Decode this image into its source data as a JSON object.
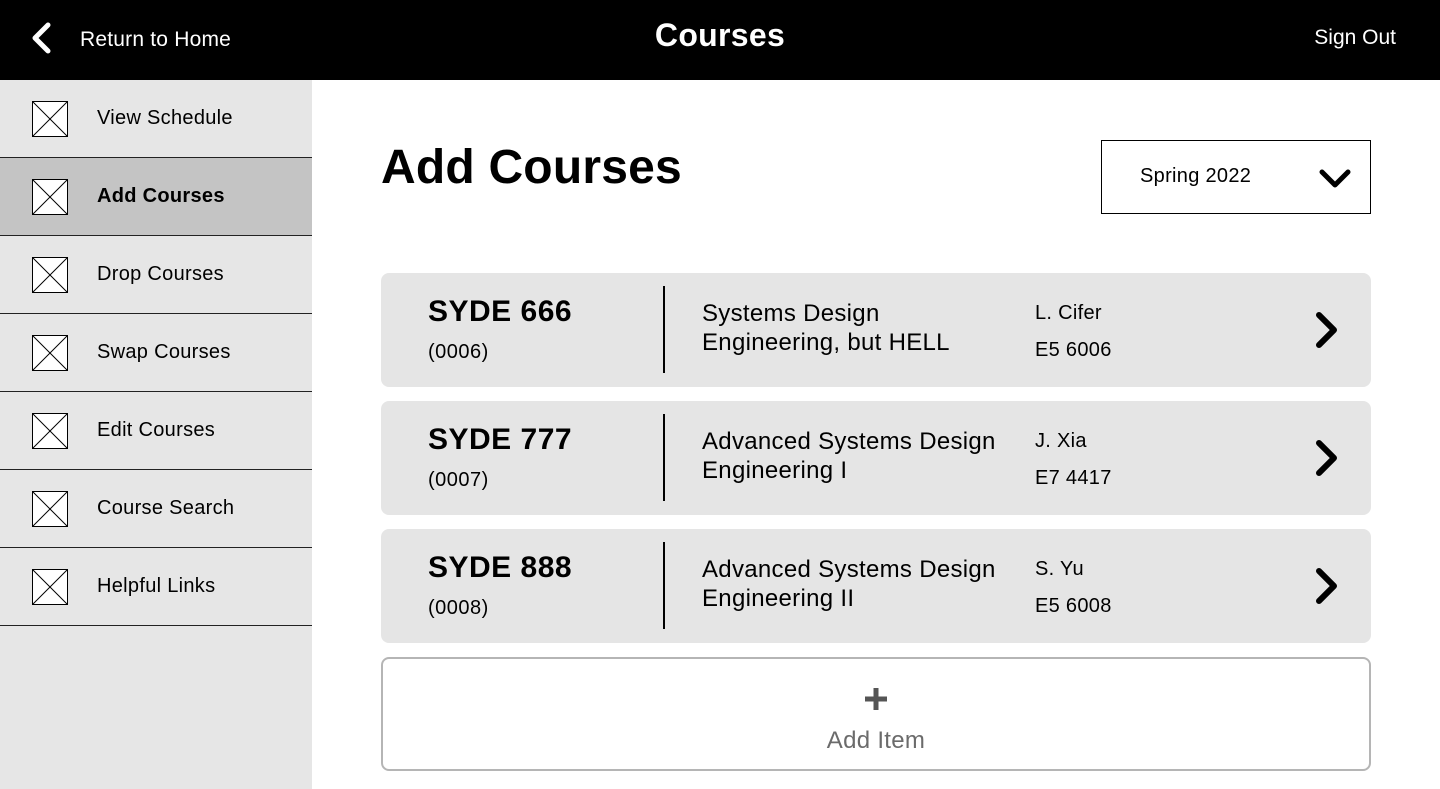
{
  "header": {
    "back_label": "Return to Home",
    "title": "Courses",
    "sign_out_label": "Sign Out"
  },
  "sidebar": {
    "active_index": 1,
    "items": [
      {
        "label": "View Schedule",
        "icon": "placeholder-image-icon"
      },
      {
        "label": "Add Courses",
        "icon": "placeholder-image-icon"
      },
      {
        "label": "Drop Courses",
        "icon": "placeholder-image-icon"
      },
      {
        "label": "Swap Courses",
        "icon": "placeholder-image-icon"
      },
      {
        "label": "Edit Courses",
        "icon": "placeholder-image-icon"
      },
      {
        "label": "Course Search",
        "icon": "placeholder-image-icon"
      },
      {
        "label": "Helpful Links",
        "icon": "placeholder-image-icon"
      }
    ]
  },
  "main": {
    "heading": "Add Courses",
    "term_select": {
      "value": "Spring 2022",
      "icon": "chevron-down-icon"
    },
    "courses": [
      {
        "code": "SYDE 666",
        "section": "(0006)",
        "name": "Systems Design Engineering, but HELL",
        "instructor": "L. Cifer",
        "room": "E5 6006"
      },
      {
        "code": "SYDE 777",
        "section": "(0007)",
        "name": "Advanced Systems Design Engineering I",
        "instructor": "J. Xia",
        "room": "E7 4417"
      },
      {
        "code": "SYDE 888",
        "section": "(0008)",
        "name": "Advanced Systems Design Engineering II",
        "instructor": "S. Yu",
        "room": "E5 6008"
      }
    ],
    "add_item_label": "Add Item"
  },
  "colors": {
    "header_bg": "#000000",
    "sidebar_bg": "#e6e6e6",
    "sidebar_active_bg": "#c4c4c4",
    "card_bg": "#e5e5e5",
    "add_item_border": "#b5b5b5",
    "add_item_text": "#6b6b6b"
  }
}
